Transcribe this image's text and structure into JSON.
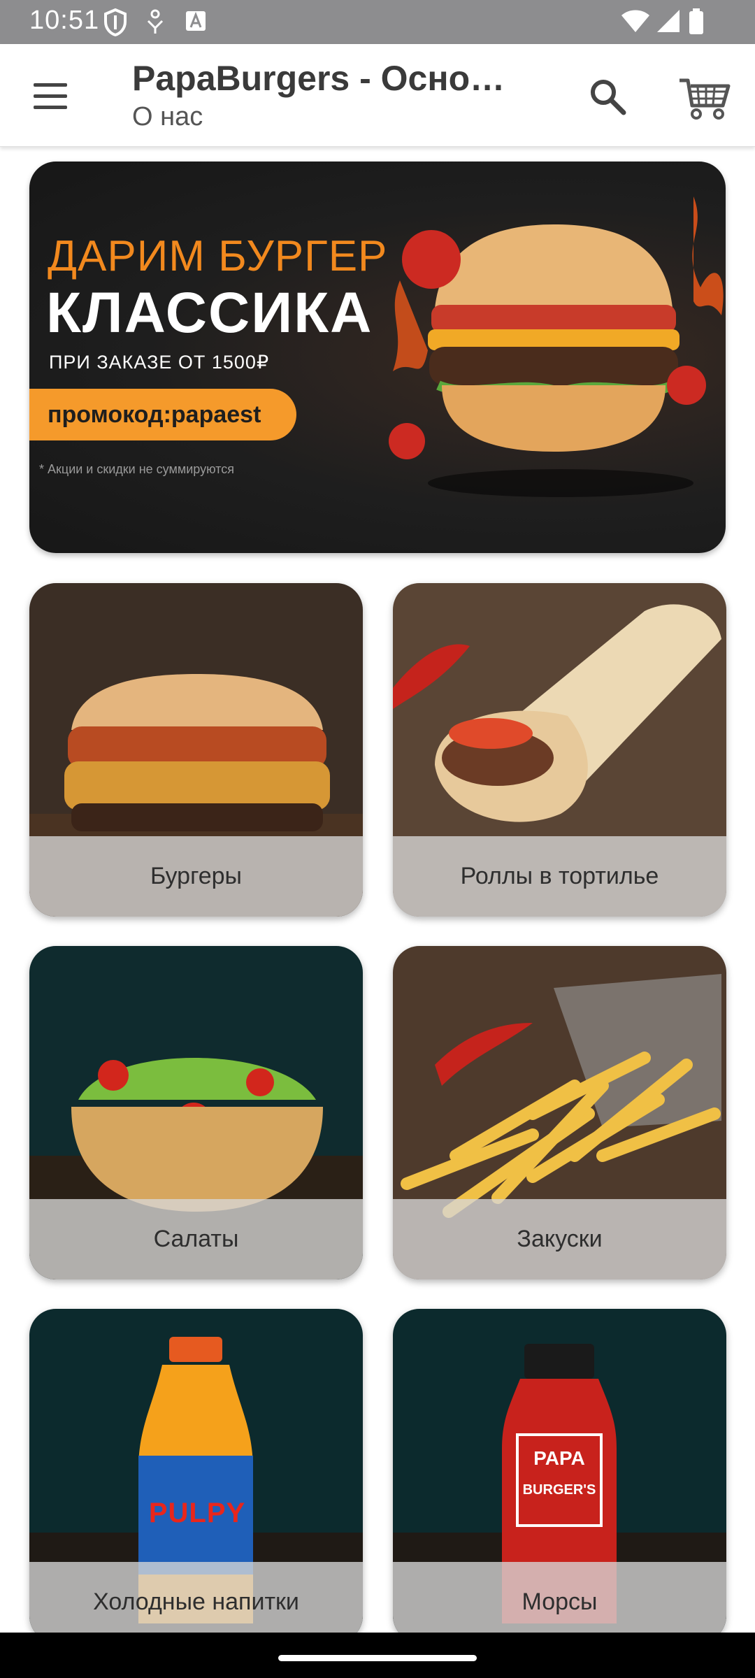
{
  "status_bar": {
    "time": "10:51",
    "icons": [
      "shield-icon",
      "vpn-key-icon",
      "text-a-icon",
      "wifi-icon",
      "signal-icon",
      "battery-icon"
    ]
  },
  "app_bar": {
    "title": "PapaBurgers - Осно…",
    "subtitle": "О нас",
    "icons": [
      "menu-icon",
      "search-icon",
      "cart-icon"
    ]
  },
  "promo": {
    "line1": "ДАРИМ БУРГЕР",
    "line2": "КЛАССИКА",
    "line3": "ПРИ ЗАКАЗЕ ОТ 1500₽",
    "code": "промокод:papaest",
    "note": "* Акции и скидки не суммируются"
  },
  "categories": [
    {
      "label": "Бургеры"
    },
    {
      "label": "Роллы в тортилье"
    },
    {
      "label": "Салаты"
    },
    {
      "label": "Закуски"
    },
    {
      "label": "Холодные напитки"
    },
    {
      "label": "Морсы"
    }
  ],
  "images": {
    "drink1_brand": "PULPY",
    "drink2_brand_line1": "PAPA",
    "drink2_brand_line2": "BURGER'S"
  },
  "colors": {
    "accent_orange": "#f59a2b",
    "status_bar": "#8d8d8f",
    "card_label_bg": "#d7d7d7"
  }
}
